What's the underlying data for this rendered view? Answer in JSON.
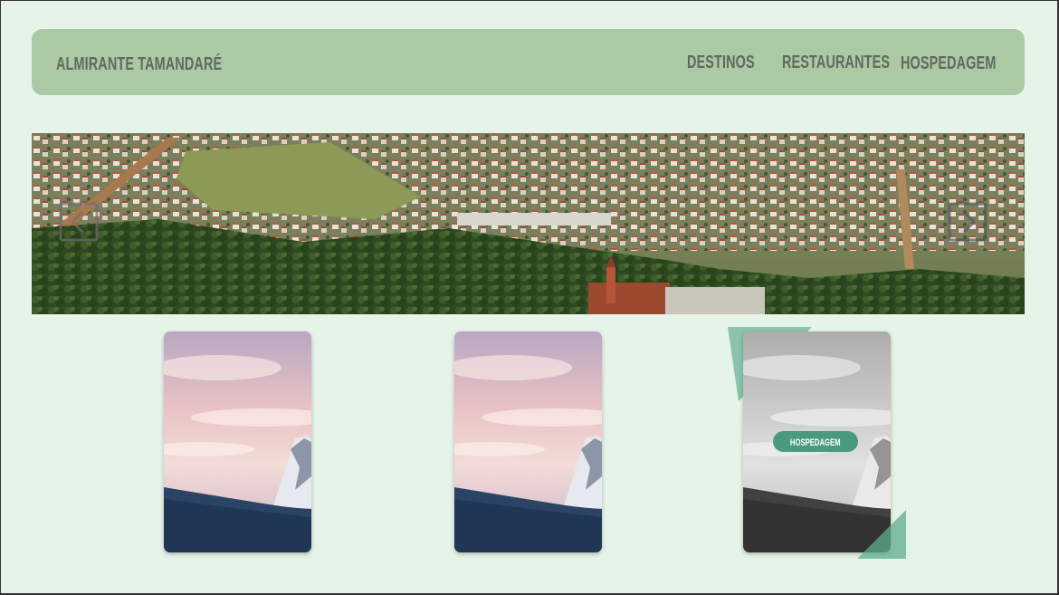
{
  "header": {
    "brand": "ALMIRANTE TAMANDARÉ",
    "nav": [
      "DESTINOS",
      "RESTAURANTES",
      "HOSPEDAGEM"
    ]
  },
  "hero": {
    "prev_icon": "chevron-left-icon",
    "next_icon": "chevron-right-icon"
  },
  "cards": [
    {
      "image": "mountain-sunset-photo"
    },
    {
      "image": "mountain-sunset-photo"
    },
    {
      "image": "mountain-sunset-photo-grayscale",
      "badge": "HOSPEDAGEM"
    }
  ],
  "colors": {
    "background": "#e6f3e9",
    "navbar": "#abc9a3",
    "nav_text": "#5f6a60",
    "badge": "#4a9a7e",
    "accent_triangle": "#7fbfa6"
  }
}
